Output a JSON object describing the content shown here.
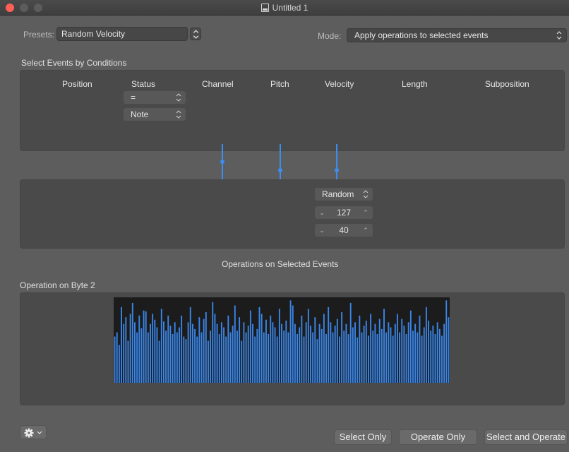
{
  "window": {
    "title": "Untitled 1"
  },
  "presets": {
    "label": "Presets:",
    "value": "Random Velocity"
  },
  "mode": {
    "label": "Mode:",
    "value": "Apply operations to selected events"
  },
  "conditions": {
    "heading": "Select Events by Conditions",
    "columns": [
      "Position",
      "Status",
      "Channel",
      "Pitch",
      "Velocity",
      "Length",
      "Subposition"
    ],
    "status_operator": "=",
    "status_value": "Note"
  },
  "operations": {
    "velocity_mode": "Random",
    "value1": "127",
    "value2": "40",
    "heading": "Operations on Selected Events"
  },
  "byte2": {
    "heading": "Operation on Byte 2"
  },
  "histogram_levels": [
    0.55,
    0.6,
    0.45,
    0.9,
    0.7,
    0.78,
    0.5,
    0.82,
    0.95,
    0.72,
    0.6,
    0.8,
    0.65,
    0.86,
    0.85,
    0.6,
    0.7,
    0.82,
    0.75,
    0.66,
    0.5,
    0.88,
    0.73,
    0.62,
    0.8,
    0.68,
    0.58,
    0.72,
    0.6,
    0.66,
    0.8,
    0.55,
    0.52,
    0.72,
    0.9,
    0.7,
    0.64,
    0.55,
    0.78,
    0.6,
    0.76,
    0.84,
    0.5,
    0.62,
    0.96,
    0.82,
    0.7,
    0.58,
    0.72,
    0.66,
    0.55,
    0.8,
    0.6,
    0.68,
    0.92,
    0.62,
    0.78,
    0.5,
    0.72,
    0.6,
    0.68,
    0.86,
    0.7,
    0.55,
    0.64,
    0.9,
    0.82,
    0.6,
    0.75,
    0.58,
    0.8,
    0.72,
    0.66,
    0.55,
    0.88,
    0.7,
    0.62,
    0.74,
    0.6,
    0.98,
    0.92,
    0.7,
    0.58,
    0.66,
    0.8,
    0.55,
    0.72,
    0.88,
    0.68,
    0.6,
    0.78,
    0.52,
    0.7,
    0.64,
    0.82,
    0.58,
    0.9,
    0.72,
    0.6,
    0.68,
    0.76,
    0.55,
    0.84,
    0.62,
    0.7,
    0.58,
    0.95,
    0.66,
    0.72,
    0.54,
    0.8,
    0.6,
    0.68,
    0.74,
    0.56,
    0.82,
    0.62,
    0.7,
    0.58,
    0.76,
    0.64,
    0.88,
    0.6,
    0.72,
    0.66,
    0.56,
    0.7,
    0.82,
    0.6,
    0.76,
    0.68,
    0.58,
    0.72,
    0.86,
    0.62,
    0.7,
    0.6,
    0.8,
    0.56,
    0.66,
    0.9,
    0.74,
    0.62,
    0.68,
    0.58,
    0.72,
    0.64,
    0.56,
    0.7,
    0.98,
    0.78
  ],
  "colors": {
    "accent": "#3d8cf0",
    "bar": "#3a86e8",
    "background": "#5d5d5d",
    "panel": "#4a4a4a"
  },
  "footer": {
    "gear_icon": "gear-icon",
    "select_only": "Select Only",
    "operate_only": "Operate Only",
    "select_and_operate": "Select and Operate"
  }
}
